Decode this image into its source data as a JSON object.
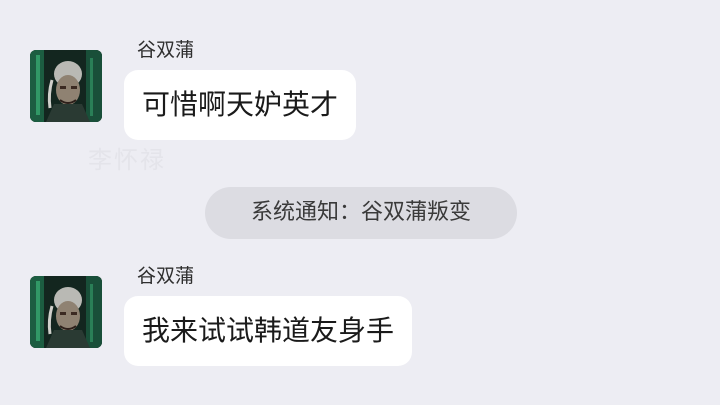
{
  "messages": [
    {
      "sender": "谷双蒲",
      "text": "可惜啊天妒英才"
    },
    {
      "sender": "谷双蒲",
      "text": "我来试试韩道友身手"
    }
  ],
  "system_notice": "系统通知：谷双蒲叛变",
  "watermark": "李怀禄",
  "colors": {
    "background": "#ededf3",
    "bubble": "#ffffff",
    "system_pill": "#dcdce2"
  }
}
